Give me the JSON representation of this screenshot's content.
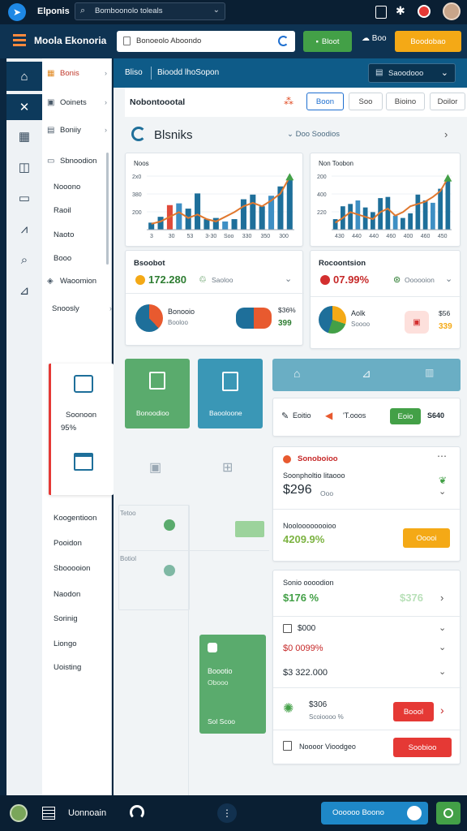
{
  "topbar": {
    "app_name": "Elponis",
    "search_value": "Bomboonolo toleals",
    "colors": {
      "bg": "#0a1f33",
      "record": "#e53935"
    }
  },
  "header": {
    "title": "Moola Ekonoria",
    "search_value": "Bonoeolo Aboondo",
    "green_button": "Bloot",
    "cloud_label": "Boo",
    "orange_button": "Boodobao",
    "colors": {
      "bg": "#0e3352",
      "green": "#43a047",
      "orange": "#f4a916"
    }
  },
  "rail": {
    "icons": [
      "home-icon",
      "shuffle-icon",
      "grid-icon",
      "box-icon",
      "document-icon",
      "chart-icon",
      "search-icon",
      "analytics-icon"
    ]
  },
  "sidebar": {
    "items": [
      {
        "label": "Bonis",
        "icon": "dashboard-icon",
        "active": true
      },
      {
        "label": "Ooinets",
        "icon": "wallet-icon"
      },
      {
        "label": "Boniiy",
        "icon": "calendar-icon"
      },
      {
        "label": "Sbnoodion",
        "icon": "folder-icon"
      },
      {
        "label": "Nooono"
      },
      {
        "label": "Raoil"
      },
      {
        "label": "Naoto"
      },
      {
        "label": "Booo"
      },
      {
        "label": "Waoomion",
        "icon": "tag-icon"
      },
      {
        "label": "Snoosly"
      }
    ],
    "promo": {
      "label": "Soonoon",
      "percent": "95%"
    },
    "footer_items": [
      "Koogentioon",
      "Pooidon",
      "Sbooooion",
      "Naodon",
      "Sorinig",
      "Liongo",
      "Uoisting"
    ]
  },
  "main": {
    "breadcrumb": [
      "Bliso",
      "Bioodd lhoSopon"
    ],
    "select_label": "Saoodooo",
    "filter_title": "Nobontoootal",
    "filters": [
      "Boon",
      "Soo",
      "Bioino",
      "Doilor"
    ],
    "section_title": "Blsniks",
    "section_link": "Doo Soodios",
    "chart_left": {
      "title": "Noos",
      "ticks": [
        "2x0",
        "380",
        "200"
      ],
      "xlabels": [
        "3",
        "30",
        "53",
        "3-30",
        "Soo",
        "330",
        "350",
        "300"
      ]
    },
    "chart_right": {
      "title": "Non Toobon",
      "ticks": [
        "200",
        "400",
        "220"
      ],
      "xlabels": [
        "430",
        "440",
        "440",
        "460",
        "400",
        "460",
        "450"
      ]
    },
    "stat_left": {
      "title": "Bsoobot",
      "value": "172.280",
      "tag": "Saoloo"
    },
    "stat_right": {
      "title": "Rocoontsion",
      "value": "07.99%",
      "tag": "Oooooion"
    },
    "donut_left": {
      "label": "Bonooio",
      "sub": "Booloo",
      "amount": "$36%",
      "change": "399"
    },
    "donut_right": {
      "label": "Aolk",
      "sub": "Soooo",
      "amount": "$56",
      "change": "339"
    },
    "tiles": [
      "Bonoodioo",
      "Baooloone"
    ],
    "tabs": {
      "label1": "Eoitio",
      "label2": "'T.ooos",
      "btn": "Eoio",
      "value": "S640"
    },
    "panel1": {
      "title": "Sonoboioo",
      "sub": "Soonpholtio litaooo",
      "amount": "$296",
      "amount_tag": "Ooo",
      "label2": "Nooloooooooioo",
      "value2": "4209.9%",
      "btn": "Ooooi"
    },
    "panel2": {
      "title": "Sonio oooodion",
      "value1": "$176 %",
      "value1b": "$376",
      "row1": "$000",
      "row2": "$0 0099%",
      "row3": "$3 322.000",
      "row4_amount": "$306",
      "row4_sub": "Scoioooo %",
      "row4_btn": "Boool",
      "row5": "Noooor Vioodgeo",
      "row5_btn": "Soobioo"
    },
    "list_tags": [
      "Tetoo",
      "Botiol"
    ],
    "green_card": {
      "title": "Boootio",
      "sub": "Obooo",
      "footer": "Sol Scoo"
    }
  },
  "bottombar": {
    "label": "Uonnoain",
    "action": "Oooooo Boono"
  },
  "chart_data": [
    {
      "type": "bar",
      "title": "Noos",
      "categories": [
        "3",
        "30",
        "53",
        "3-30",
        "Soo",
        "330",
        "350",
        "300"
      ],
      "series": [
        {
          "values": [
            12,
            22,
            42,
            45,
            36,
            62,
            18,
            20,
            14,
            18,
            52,
            60,
            40,
            58,
            74,
            88
          ]
        },
        {
          "values": [
            10,
            14,
            22,
            30,
            20,
            26,
            18,
            14,
            22,
            30,
            40,
            46,
            40,
            50,
            62,
            90
          ]
        }
      ],
      "ylim": [
        0,
        100
      ]
    },
    {
      "type": "bar",
      "title": "Non Toobon",
      "categories": [
        "430",
        "440",
        "440",
        "460",
        "400",
        "460",
        "450"
      ],
      "series": [
        {
          "values": [
            18,
            40,
            44,
            50,
            38,
            30,
            54,
            56,
            24,
            20,
            28,
            60,
            50,
            46,
            70,
            84
          ]
        },
        {
          "values": [
            12,
            20,
            30,
            26,
            22,
            18,
            30,
            36,
            24,
            30,
            40,
            44,
            48,
            56,
            66,
            88
          ]
        }
      ],
      "ylim": [
        0,
        100
      ]
    }
  ]
}
